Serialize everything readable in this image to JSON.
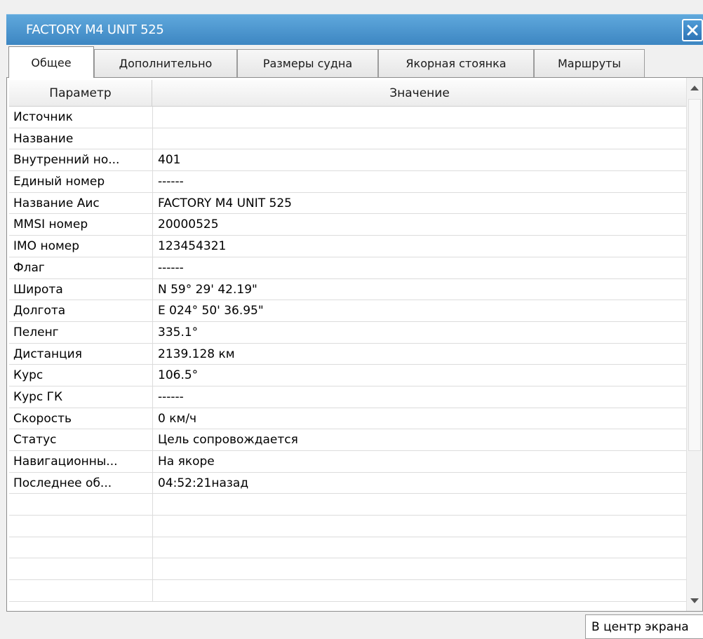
{
  "window": {
    "title": "FACTORY M4 UNIT 525"
  },
  "tabs": [
    {
      "label": "Общее",
      "active": true
    },
    {
      "label": "Дополнительно",
      "active": false
    },
    {
      "label": "Размеры судна",
      "active": false
    },
    {
      "label": "Якорная стоянка",
      "active": false
    },
    {
      "label": "Маршруты",
      "active": false
    }
  ],
  "grid": {
    "header": {
      "param": "Параметр",
      "value": "Значение"
    },
    "rows": [
      {
        "param": "Источник",
        "value": ""
      },
      {
        "param": "Название",
        "value": ""
      },
      {
        "param": "Внутренний но...",
        "value": "401"
      },
      {
        "param": "Единый номер",
        "value": "------"
      },
      {
        "param": "Название Аис",
        "value": "FACTORY M4 UNIT 525"
      },
      {
        "param": "MMSI номер",
        "value": "20000525"
      },
      {
        "param": "IMO номер",
        "value": "123454321"
      },
      {
        "param": "Флаг",
        "value": "------"
      },
      {
        "param": "Широта",
        "value": "N   59° 29' 42.19\""
      },
      {
        "param": "Долгота",
        "value": "E  024° 50' 36.95\""
      },
      {
        "param": "Пеленг",
        "value": "335.1°"
      },
      {
        "param": "Дистанция",
        "value": "2139.128 км"
      },
      {
        "param": "Курс",
        "value": "106.5°"
      },
      {
        "param": "Курс ГК",
        "value": "------"
      },
      {
        "param": "Скорость",
        "value": "0 км/ч"
      },
      {
        "param": "Статус",
        "value": "Цель сопровождается"
      },
      {
        "param": "Навигационны...",
        "value": "На якоре"
      },
      {
        "param": "Последнее об...",
        "value": "04:52:21назад"
      },
      {
        "param": "",
        "value": ""
      },
      {
        "param": "",
        "value": ""
      },
      {
        "param": "",
        "value": ""
      },
      {
        "param": "",
        "value": ""
      },
      {
        "param": "",
        "value": ""
      }
    ]
  },
  "footer": {
    "center_button": "В центр экрана"
  },
  "icons": {
    "close": "close-icon",
    "scroll_up": "arrow-up-icon",
    "scroll_down": "arrow-down-icon"
  },
  "colors": {
    "titlebar": "#3d86c2",
    "title_text": "#ffffff"
  }
}
